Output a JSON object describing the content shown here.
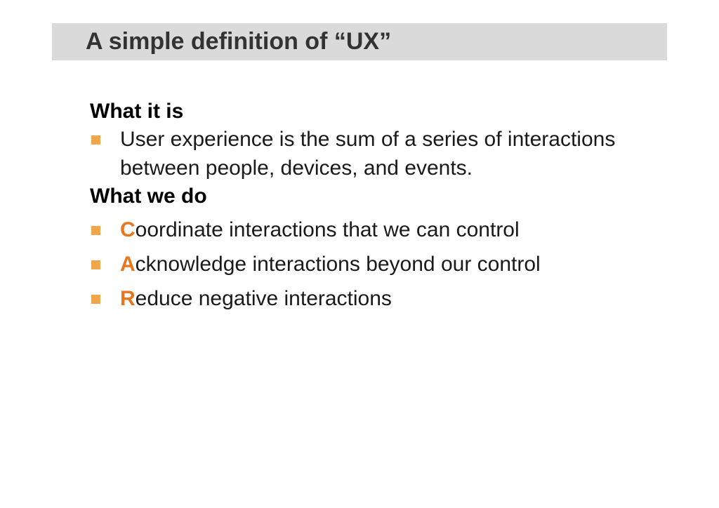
{
  "slide": {
    "title": "A simple definition of “UX”",
    "sections": [
      {
        "heading": "What it is",
        "items": [
          {
            "text": "User experience is the sum of a series of interactions between people, devices, and events."
          }
        ]
      },
      {
        "heading": "What we do",
        "items": [
          {
            "initial": "C",
            "rest": "oordinate interactions that we can control"
          },
          {
            "initial": "A",
            "rest": "cknowledge interactions beyond our control"
          },
          {
            "initial": "R",
            "rest": "educe negative interactions"
          }
        ]
      }
    ]
  },
  "colors": {
    "title_bar": "#dadada",
    "bullet": "#f0a64a",
    "accent_initial": "#e8761f"
  },
  "icons": {
    "bullet": "square-bullet-icon"
  }
}
